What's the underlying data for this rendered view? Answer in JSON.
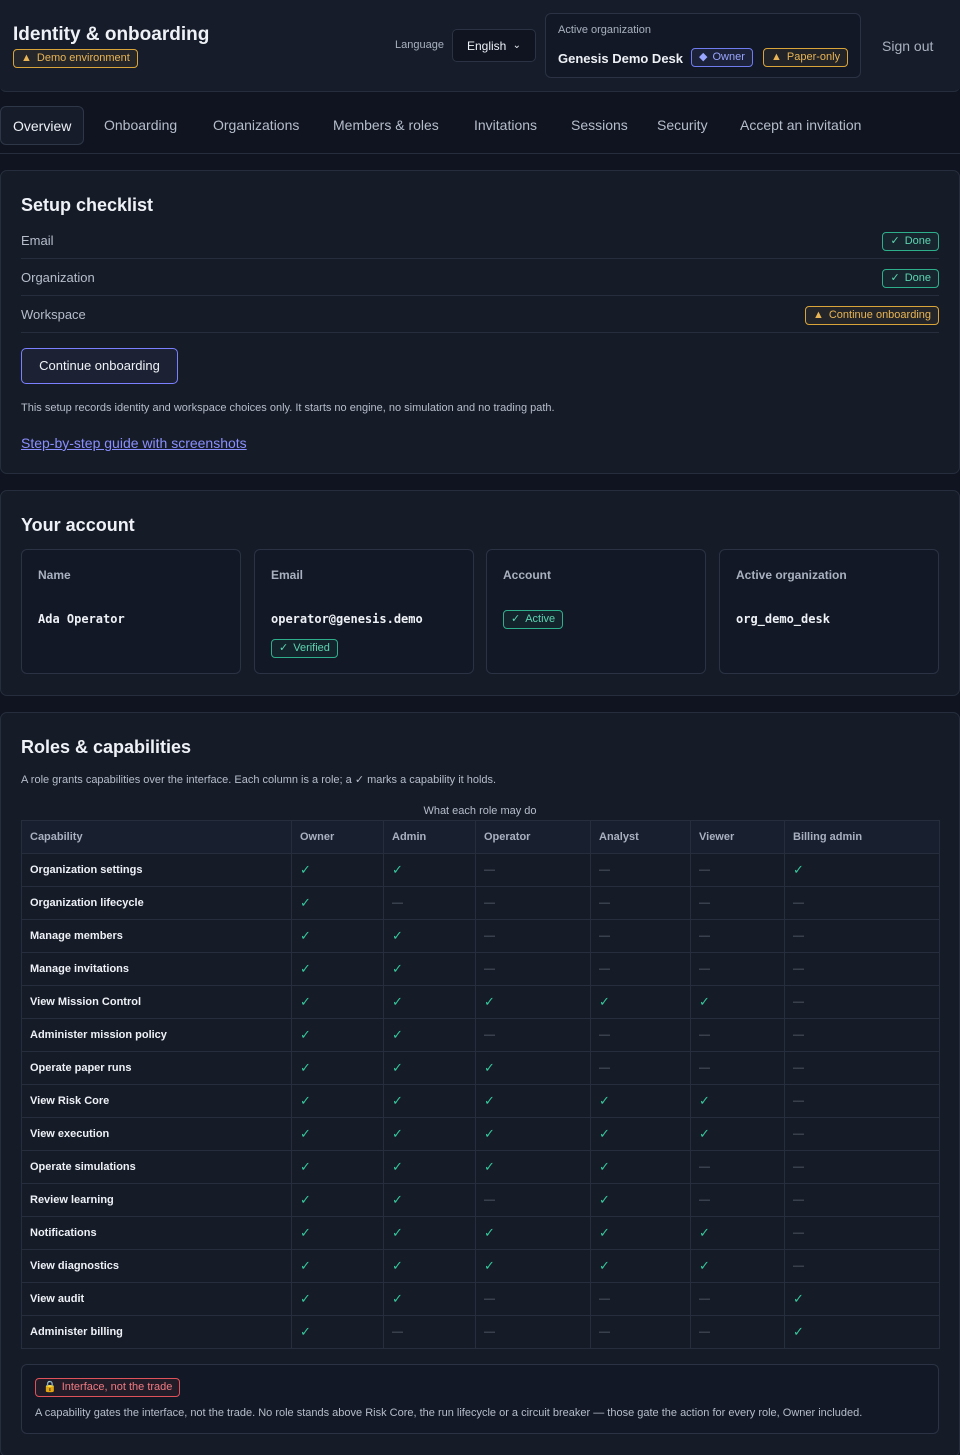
{
  "header": {
    "title": "Identity & onboarding",
    "demo_badge": "Demo environment",
    "language_label": "Language",
    "language_value": "English",
    "org_label": "Active organization",
    "org_name": "Genesis Demo Desk",
    "owner_badge": "Owner",
    "paper_badge": "Paper-only",
    "sign_out": "Sign out"
  },
  "tabs": [
    {
      "label": "Overview",
      "active": true
    },
    {
      "label": "Onboarding"
    },
    {
      "label": "Organizations"
    },
    {
      "label": "Members & roles"
    },
    {
      "label": "Invitations"
    },
    {
      "label": "Sessions"
    },
    {
      "label": "Security"
    },
    {
      "label": "Accept an invitation"
    }
  ],
  "setup": {
    "title": "Setup checklist",
    "items": [
      {
        "label": "Email",
        "status": "Done"
      },
      {
        "label": "Organization",
        "status": "Done"
      },
      {
        "label": "Workspace",
        "status": "Continue onboarding"
      }
    ],
    "button": "Continue onboarding",
    "note": "This setup records identity and workspace choices only. It starts no engine, no simulation and no trading path.",
    "link": "Step-by-step guide with screenshots"
  },
  "account": {
    "title": "Your account",
    "cards": [
      {
        "label": "Name",
        "value": "Ada Operator"
      },
      {
        "label": "Email",
        "value": "operator@genesis.demo",
        "badge": "Verified"
      },
      {
        "label": "Account",
        "badge": "Active"
      },
      {
        "label": "Active organization",
        "value": "org_demo_desk"
      }
    ]
  },
  "roles": {
    "title": "Roles & capabilities",
    "note": "A role grants capabilities over the interface. Each column is a role; a ✓ marks a capability it holds.",
    "caption": "What each role may do",
    "capability_header": "Capability",
    "columns": [
      "Owner",
      "Admin",
      "Operator",
      "Analyst",
      "Viewer",
      "Billing admin"
    ],
    "rows": [
      {
        "capability": "Organization settings",
        "grants": [
          1,
          1,
          0,
          0,
          0,
          1
        ]
      },
      {
        "capability": "Organization lifecycle",
        "grants": [
          1,
          0,
          0,
          0,
          0,
          0
        ]
      },
      {
        "capability": "Manage members",
        "grants": [
          1,
          1,
          0,
          0,
          0,
          0
        ]
      },
      {
        "capability": "Manage invitations",
        "grants": [
          1,
          1,
          0,
          0,
          0,
          0
        ]
      },
      {
        "capability": "View Mission Control",
        "grants": [
          1,
          1,
          1,
          1,
          1,
          0
        ]
      },
      {
        "capability": "Administer mission policy",
        "grants": [
          1,
          1,
          0,
          0,
          0,
          0
        ]
      },
      {
        "capability": "Operate paper runs",
        "grants": [
          1,
          1,
          1,
          0,
          0,
          0
        ]
      },
      {
        "capability": "View Risk Core",
        "grants": [
          1,
          1,
          1,
          1,
          1,
          0
        ]
      },
      {
        "capability": "View execution",
        "grants": [
          1,
          1,
          1,
          1,
          1,
          0
        ]
      },
      {
        "capability": "Operate simulations",
        "grants": [
          1,
          1,
          1,
          1,
          0,
          0
        ]
      },
      {
        "capability": "Review learning",
        "grants": [
          1,
          1,
          0,
          1,
          0,
          0
        ]
      },
      {
        "capability": "Notifications",
        "grants": [
          1,
          1,
          1,
          1,
          1,
          0
        ]
      },
      {
        "capability": "View diagnostics",
        "grants": [
          1,
          1,
          1,
          1,
          1,
          0
        ]
      },
      {
        "capability": "View audit",
        "grants": [
          1,
          1,
          0,
          0,
          0,
          1
        ]
      },
      {
        "capability": "Administer billing",
        "grants": [
          1,
          0,
          0,
          0,
          0,
          1
        ]
      }
    ],
    "yes_mark": "✓",
    "no_mark": "—",
    "notice_badge": "Interface, not the trade",
    "notice_text": "A capability gates the interface, not the trade. No role stands above Risk Core, the run lifecycle or a circuit breaker — those gate the action for every role, Owner included."
  },
  "colors": {
    "background": "#0f1420",
    "panel": "#151b27",
    "accent": "#7a80ff",
    "success": "#36c79a",
    "warning": "#e8b455",
    "danger": "#f07a80"
  },
  "icons": {
    "check": "check-icon",
    "warning": "warning-icon",
    "diamond": "diamond-icon",
    "lock": "lock-icon",
    "chevron": "chevron-down-icon"
  }
}
